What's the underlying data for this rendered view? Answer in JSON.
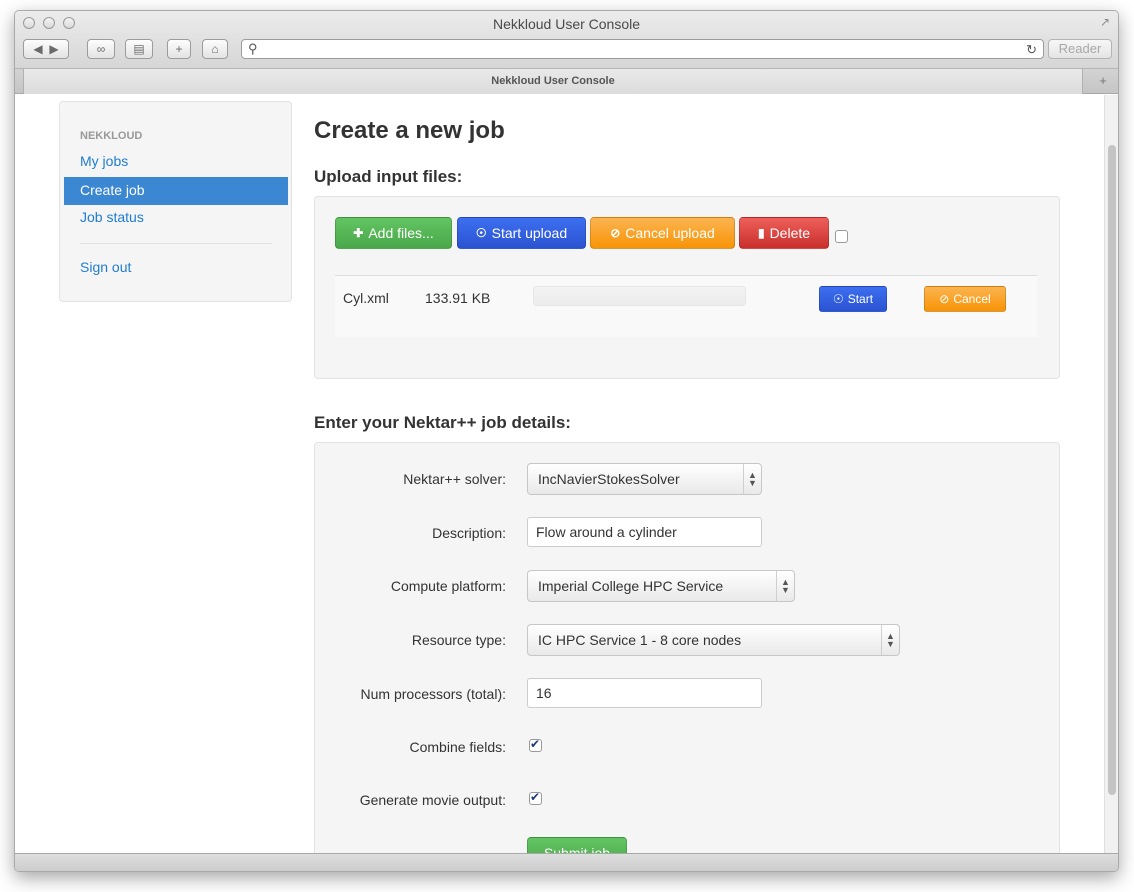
{
  "window": {
    "title": "Nekkloud User Console",
    "reader_label": "Reader"
  },
  "tab": {
    "title": "Nekkloud User Console"
  },
  "sidebar": {
    "header": "NEKKLOUD",
    "items": [
      {
        "label": "My jobs"
      },
      {
        "label": "Create job",
        "active": true
      },
      {
        "label": "Job status"
      },
      {
        "label": "Sign out"
      }
    ]
  },
  "page": {
    "title": "Create a new job",
    "upload_heading": "Upload input files:",
    "details_heading": "Enter your Nektar++ job details:"
  },
  "upload": {
    "add_files": "Add files...",
    "start_upload": "Start upload",
    "cancel_upload": "Cancel upload",
    "delete": "Delete",
    "files": [
      {
        "name": "Cyl.xml",
        "size": "133.91 KB",
        "progress": 0,
        "start": "Start",
        "cancel": "Cancel"
      }
    ]
  },
  "form": {
    "solver_label": "Nektar++ solver:",
    "solver_value": "IncNavierStokesSolver",
    "description_label": "Description:",
    "description_value": "Flow around a cylinder",
    "platform_label": "Compute platform:",
    "platform_value": "Imperial College HPC Service",
    "resource_label": "Resource type:",
    "resource_value": "IC HPC Service 1 - 8 core nodes",
    "procs_label": "Num processors (total):",
    "procs_value": "16",
    "combine_label": "Combine fields:",
    "combine_checked": true,
    "movie_label": "Generate movie output:",
    "movie_checked": true,
    "submit": "Submit job"
  },
  "colors": {
    "accent": "#3b87d2",
    "link": "#1f7dcf",
    "success": "#4aa84a",
    "primary": "#2b53d1",
    "warning": "#f89406",
    "danger": "#c9302c"
  }
}
